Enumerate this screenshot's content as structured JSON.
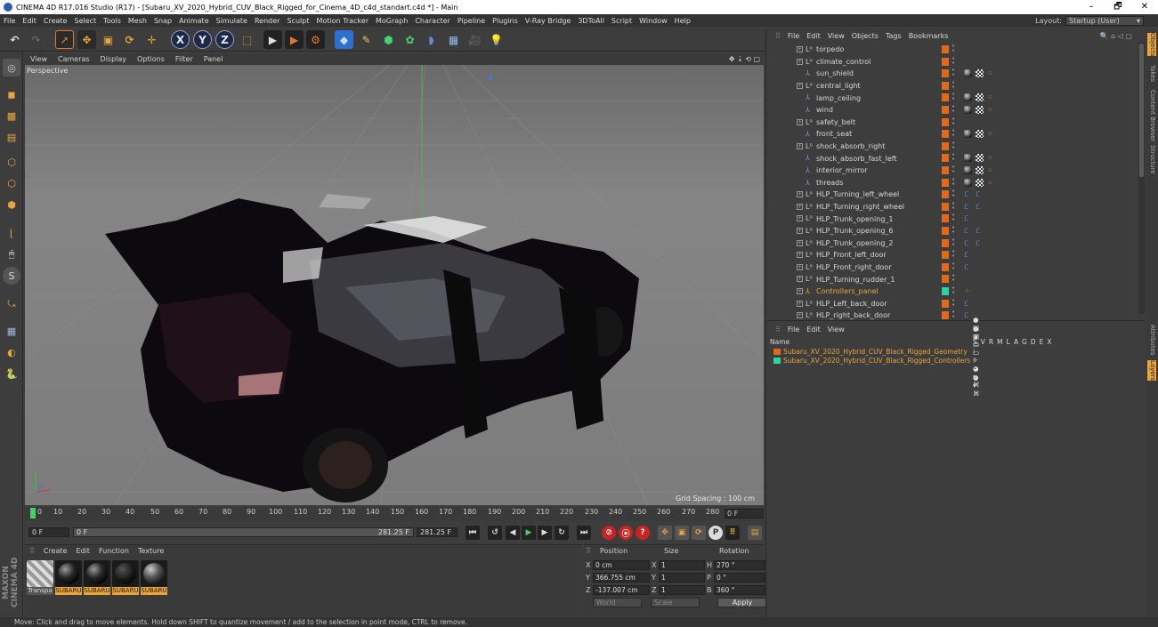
{
  "window": {
    "title": "CINEMA 4D R17.016 Studio (R17) - [Subaru_XV_2020_Hybrid_CUV_Black_Rigged_for_Cinema_4D_c4d_standart.c4d *] - Main",
    "minimize": "–",
    "maximize": "🗗",
    "close": "✕"
  },
  "menubar": {
    "items": [
      "File",
      "Edit",
      "Create",
      "Select",
      "Tools",
      "Mesh",
      "Snap",
      "Animate",
      "Simulate",
      "Render",
      "Sculpt",
      "Motion Tracker",
      "MoGraph",
      "Character",
      "Pipeline",
      "Plugins",
      "V-Ray Bridge",
      "3DToAll",
      "Script",
      "Window",
      "Help"
    ],
    "layout_label": "Layout:",
    "layout_value": "Startup (User)"
  },
  "viewport": {
    "menu": [
      "View",
      "Cameras",
      "Display",
      "Options",
      "Filter",
      "Panel"
    ],
    "label": "Perspective",
    "grid_spacing": "Grid Spacing : 100 cm"
  },
  "timeline": {
    "ticks": [
      "0",
      "10",
      "20",
      "30",
      "40",
      "50",
      "60",
      "70",
      "80",
      "90",
      "100",
      "110",
      "120",
      "130",
      "140",
      "150",
      "160",
      "170",
      "180",
      "190",
      "200",
      "210",
      "220",
      "230",
      "240",
      "250",
      "260",
      "270",
      "280"
    ],
    "current_frame": "0 F"
  },
  "transport": {
    "start": "0 F",
    "scrub": "0 F",
    "end_a": "281.25 F",
    "end_b": "281.25 F"
  },
  "materials": {
    "menu": [
      "Create",
      "Edit",
      "Function",
      "Texture"
    ],
    "items": [
      "Transpa",
      "SUBARU",
      "SUBARU",
      "SUBARU",
      "SUBARU"
    ],
    "brand": "MAXON CINEMA 4D"
  },
  "coords": {
    "headers": [
      "Position",
      "Size",
      "Rotation"
    ],
    "rows": [
      {
        "axis": "X",
        "pos": "0 cm",
        "size": "1",
        "rlab": "H",
        "rot": "270 °"
      },
      {
        "axis": "Y",
        "pos": "366.755 cm",
        "size": "1",
        "rlab": "P",
        "rot": "0 °"
      },
      {
        "axis": "Z",
        "pos": "-137.007 cm",
        "size": "1",
        "rlab": "B",
        "rot": "360 °"
      }
    ],
    "space": "World",
    "mode": "Scale",
    "apply": "Apply"
  },
  "objects": {
    "menu": [
      "File",
      "Edit",
      "View",
      "Objects",
      "Tags",
      "Bookmarks"
    ],
    "rows": [
      {
        "name": "torpedo",
        "type": "null",
        "tags": ""
      },
      {
        "name": "climate_control",
        "type": "null",
        "tags": ""
      },
      {
        "name": "sun_shield",
        "type": "bone",
        "tags": "mat"
      },
      {
        "name": "central_light",
        "type": "null",
        "tags": ""
      },
      {
        "name": "lamp_ceiling",
        "type": "bone",
        "tags": "mat"
      },
      {
        "name": "wind",
        "type": "bone",
        "tags": "mat"
      },
      {
        "name": "safety_belt",
        "type": "null",
        "tags": ""
      },
      {
        "name": "front_seat",
        "type": "bone",
        "tags": "mat"
      },
      {
        "name": "shock_absorb_right",
        "type": "null",
        "tags": ""
      },
      {
        "name": "shock_absorb_fast_left",
        "type": "bone",
        "tags": "mat"
      },
      {
        "name": "interior_mirror",
        "type": "bone",
        "tags": "mat"
      },
      {
        "name": "threads",
        "type": "bone",
        "tags": "mat"
      },
      {
        "name": "HLP_Turning_left_wheel",
        "type": "null",
        "tags": "hlp"
      },
      {
        "name": "HLP_Turning_right_wheel",
        "type": "null",
        "tags": "hlp"
      },
      {
        "name": "HLP_Trunk_opening_1",
        "type": "null",
        "tags": "hlp1"
      },
      {
        "name": "HLP_Trunk_opening_6",
        "type": "null",
        "tags": "hlp"
      },
      {
        "name": "HLP_Trunk_opening_2",
        "type": "null",
        "tags": "hlp"
      },
      {
        "name": "HLP_Front_left_door",
        "type": "null",
        "tags": "hlp1"
      },
      {
        "name": "HLP_Front_right_door",
        "type": "null",
        "tags": "hlp1"
      },
      {
        "name": "HLP_Turning_rudder_1",
        "type": "null",
        "tags": ""
      },
      {
        "name": "Controllers_panel",
        "type": "ctrl",
        "tags": "ctrl"
      },
      {
        "name": "HLP_Left_back_door",
        "type": "null",
        "tags": "hlp1"
      },
      {
        "name": "HLP_right_back_door",
        "type": "null",
        "tags": "hlp1"
      }
    ]
  },
  "layers": {
    "menu": [
      "File",
      "Edit",
      "View"
    ],
    "header_name": "Name",
    "header_cols": [
      "S",
      "V",
      "R",
      "M",
      "L",
      "A",
      "G",
      "D",
      "E",
      "X"
    ],
    "rows": [
      {
        "name": "Subaru_XV_2020_Hybrid_CUV_Black_Rigged_Geometry",
        "color": "#e06a1a"
      },
      {
        "name": "Subaru_XV_2020_Hybrid_CUV_Black_Rigged_Controllers",
        "color": "#2bd3a0"
      }
    ]
  },
  "side_tabs": [
    "Objects",
    "Takes",
    "Content Browser",
    "Structure"
  ],
  "side_tabs_lower": [
    "Attributes",
    "Layers"
  ],
  "status": "Move: Click and drag to move elements. Hold down SHIFT to quantize movement / add to the selection in point mode, CTRL to remove."
}
